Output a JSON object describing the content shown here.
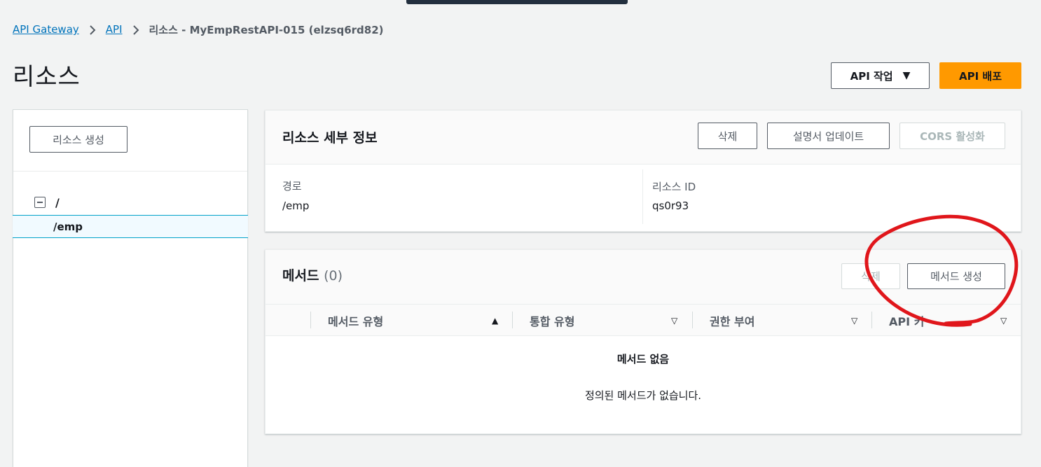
{
  "breadcrumb": {
    "items": [
      "API Gateway",
      "API"
    ],
    "current": "리소스 - MyEmpRestAPI-015 (elzsq6rd82)"
  },
  "page": {
    "title": "리소스",
    "api_action_label": "API 작업",
    "deploy_label": "API 배포"
  },
  "left_panel": {
    "create_resource_label": "리소스 생성",
    "tree": {
      "root": "/",
      "child": "/emp"
    }
  },
  "details": {
    "title": "리소스 세부 정보",
    "delete_label": "삭제",
    "update_docs_label": "설명서 업데이트",
    "cors_label": "CORS 활성화",
    "path_label": "경로",
    "path_value": "/emp",
    "resource_id_label": "리소스 ID",
    "resource_id_value": "qs0r93"
  },
  "methods": {
    "title": "메서드",
    "count": "(0)",
    "delete_label": "삭제",
    "create_method_label": "메서드 생성",
    "columns": [
      "메서드 유형",
      "통합 유형",
      "권한 부여",
      "API 키"
    ],
    "empty_title": "메서드 없음",
    "empty_description": "정의된 메서드가 없습니다."
  },
  "colors": {
    "accent": "#ff9900",
    "link": "#0073bb",
    "annotation": "#e0161b"
  }
}
